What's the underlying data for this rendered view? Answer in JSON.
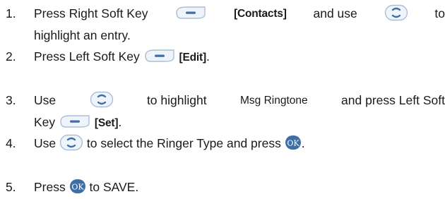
{
  "steps": [
    {
      "number": "1.",
      "parts": [
        {
          "kind": "text",
          "value": "Press Right Soft Key"
        },
        {
          "kind": "icon",
          "value": "soft-key-icon"
        },
        {
          "kind": "bold",
          "value": "[Contacts]"
        },
        {
          "kind": "text",
          "value": "and use"
        },
        {
          "kind": "icon",
          "value": "nav-key-icon"
        },
        {
          "kind": "text",
          "value": "to"
        },
        {
          "kind": "break"
        },
        {
          "kind": "text",
          "value": "highlight an entry."
        }
      ]
    },
    {
      "number": "2.",
      "parts": [
        {
          "kind": "text",
          "value": "Press Left Soft Key"
        },
        {
          "kind": "icon",
          "value": "soft-key-icon"
        },
        {
          "kind": "bold",
          "value": "[Edit]"
        },
        {
          "kind": "text",
          "value": "."
        }
      ]
    },
    {
      "number": "3.",
      "parts": [
        {
          "kind": "text",
          "value": "Use"
        },
        {
          "kind": "icon",
          "value": "nav-key-icon"
        },
        {
          "kind": "text",
          "value": "to highlight"
        },
        {
          "kind": "menu",
          "value": "Msg Ringtone"
        },
        {
          "kind": "text",
          "value": "and press Left Soft"
        },
        {
          "kind": "break"
        },
        {
          "kind": "text",
          "value": "Key"
        },
        {
          "kind": "icon",
          "value": "soft-key-icon"
        },
        {
          "kind": "bold",
          "value": "[Set]"
        },
        {
          "kind": "text",
          "value": "."
        }
      ]
    },
    {
      "number": "4.",
      "parts": [
        {
          "kind": "text",
          "value": "Use"
        },
        {
          "kind": "icon",
          "value": "nav-key-icon"
        },
        {
          "kind": "text",
          "value": "to select the Ringer Type and press"
        },
        {
          "kind": "icon",
          "value": "ok-key-icon"
        },
        {
          "kind": "text",
          "value": "."
        }
      ]
    },
    {
      "number": "5.",
      "parts": [
        {
          "kind": "text",
          "value": "Press"
        },
        {
          "kind": "icon",
          "value": "ok-key-icon"
        },
        {
          "kind": "text",
          "value": "to SAVE."
        }
      ]
    }
  ],
  "ok_label": "OK",
  "colors": {
    "text": "#1a1a1a",
    "key_fill": "#eef4fa",
    "key_border": "#a8bfd6",
    "key_accent": "#3d6fa6",
    "ok_fill": "#3d6fa6"
  }
}
